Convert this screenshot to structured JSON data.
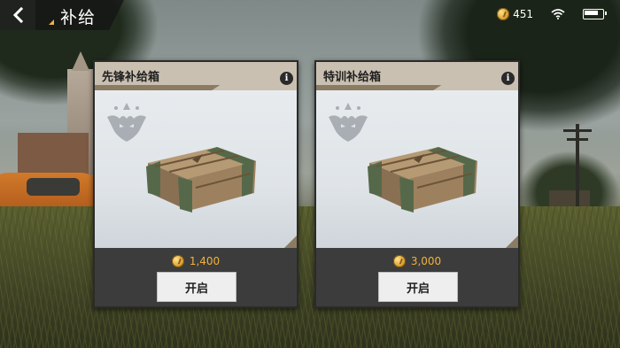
{
  "header": {
    "title": "补给",
    "back_icon": "chevron-left-icon"
  },
  "status_bar": {
    "currency_amount": "451",
    "currency_icon": "coin-icon",
    "wifi_icon": "wifi-icon",
    "battery_icon": "battery-icon"
  },
  "crates": [
    {
      "name": "先锋补给箱",
      "price": "1,400",
      "open_label": "开启",
      "info_label": "i"
    },
    {
      "name": "特训补给箱",
      "price": "3,000",
      "open_label": "开启",
      "info_label": "i"
    }
  ],
  "colors": {
    "accent_gold": "#f0b23a",
    "card_header": "#c9c0b2",
    "card_footer": "#3c3c3c"
  }
}
